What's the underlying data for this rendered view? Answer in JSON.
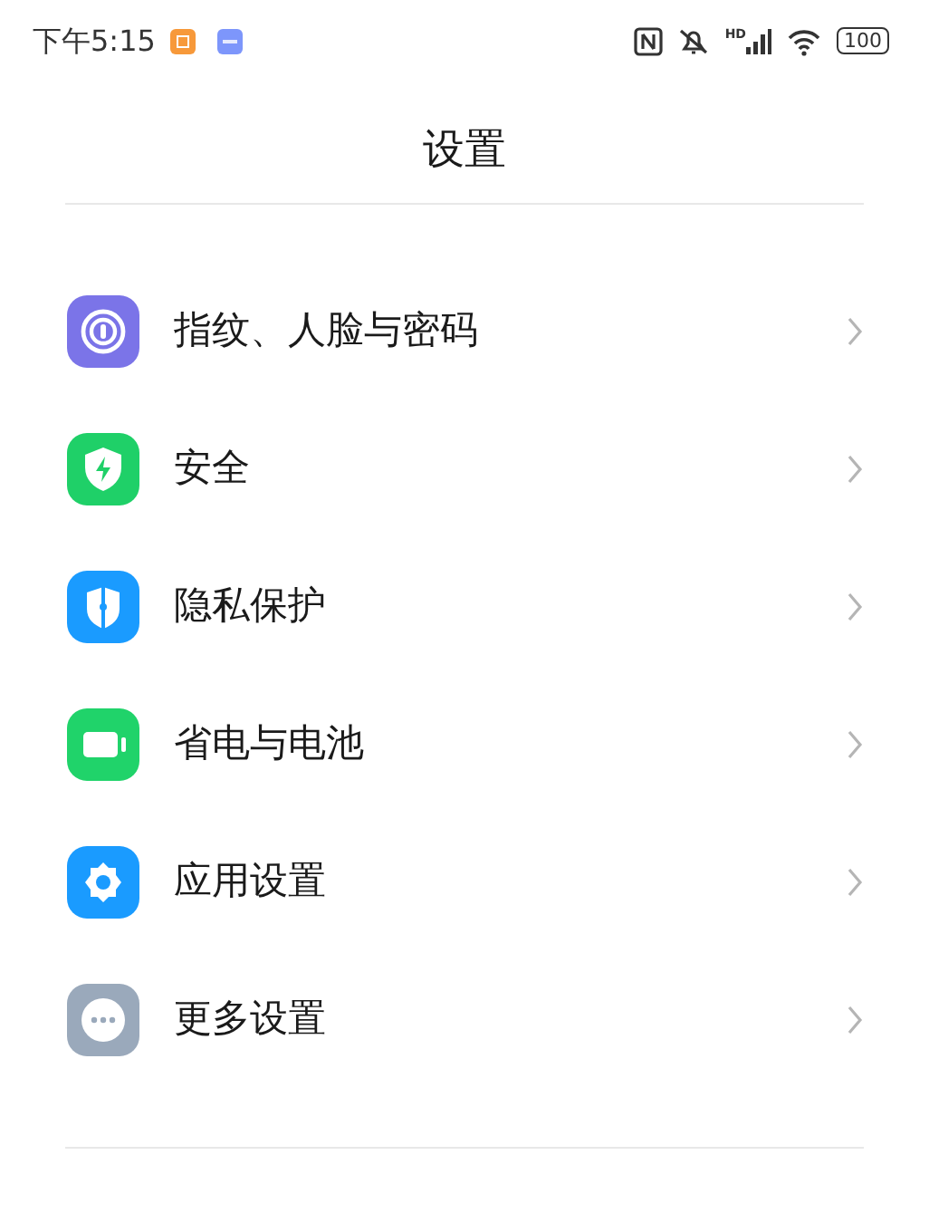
{
  "status_bar": {
    "time": "下午5:15",
    "hd": "HD",
    "battery": "100"
  },
  "title": "设置",
  "items": [
    {
      "label": "指纹、人脸与密码",
      "kind": "fingerprint",
      "color": "#7b74e8"
    },
    {
      "label": "安全",
      "kind": "shield",
      "color": "#1fd068"
    },
    {
      "label": "隐私保护",
      "kind": "privacy",
      "color": "#1a9bff"
    },
    {
      "label": "省电与电池",
      "kind": "battery",
      "color": "#20d36a"
    },
    {
      "label": "应用设置",
      "kind": "gear",
      "color": "#1a9bff"
    },
    {
      "label": "更多设置",
      "kind": "more",
      "color": "#9aa9bb"
    }
  ]
}
